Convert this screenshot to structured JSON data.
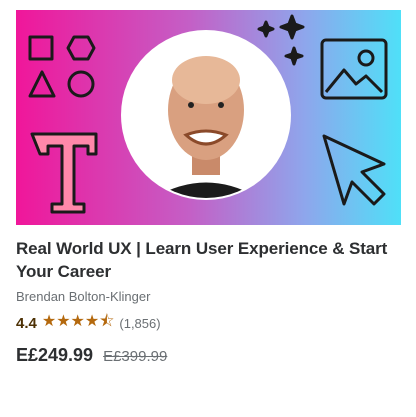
{
  "course": {
    "title": "Real World UX | Learn User Experience & Start Your Career",
    "instructor": "Brendan Bolton-Klinger",
    "rating": "4.4",
    "rating_value": 4.4,
    "stars": "★★★★⯪",
    "reviews": "(1,856)",
    "price": "E£249.99",
    "original_price": "E£399.99"
  },
  "colors": {
    "gradient_start": "#f0169a",
    "gradient_end": "#4fe0f8",
    "star": "#b4690e"
  }
}
